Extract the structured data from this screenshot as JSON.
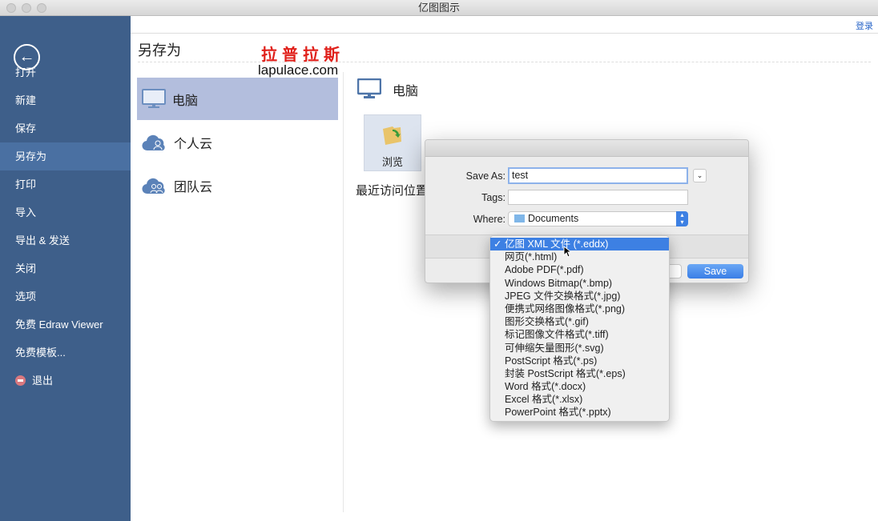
{
  "window": {
    "title": "亿图图示"
  },
  "sidebar": {
    "items": [
      {
        "label": "打开"
      },
      {
        "label": "新建"
      },
      {
        "label": "保存"
      },
      {
        "label": "另存为",
        "selected": true
      },
      {
        "label": "打印"
      },
      {
        "label": "导入"
      },
      {
        "label": "导出 & 发送"
      },
      {
        "label": "关闭"
      },
      {
        "label": "选项"
      },
      {
        "label": "免费 Edraw Viewer"
      },
      {
        "label": "免费模板..."
      },
      {
        "label": "退出"
      }
    ]
  },
  "header": {
    "login": "登录",
    "title": "另存为"
  },
  "watermark": {
    "cn": "拉普拉斯",
    "url": "lapulace.com"
  },
  "locations": [
    {
      "label": "电脑",
      "icon": "monitor-icon",
      "selected": true
    },
    {
      "label": "个人云",
      "icon": "cloud-user-icon"
    },
    {
      "label": "团队云",
      "icon": "cloud-team-icon"
    }
  ],
  "right": {
    "title": "电脑",
    "browse": "浏览",
    "recent": "最近访问位置"
  },
  "dialog": {
    "save_as_label": "Save As:",
    "save_as_value": "test",
    "tags_label": "Tags:",
    "tags_value": "",
    "where_label": "Where:",
    "where_value": "Documents",
    "save": "Save"
  },
  "format_menu": {
    "selected": 0,
    "options": [
      "亿图 XML 文件 (*.eddx)",
      "网页(*.html)",
      "Adobe PDF(*.pdf)",
      "Windows Bitmap(*.bmp)",
      "JPEG 文件交换格式(*.jpg)",
      "便携式网络图像格式(*.png)",
      "图形交换格式(*.gif)",
      "标记图像文件格式(*.tiff)",
      "可伸缩矢量图形(*.svg)",
      "PostScript 格式(*.ps)",
      "封装 PostScript 格式(*.eps)",
      "Word 格式(*.docx)",
      "Excel 格式(*.xlsx)",
      "PowerPoint 格式(*.pptx)"
    ]
  },
  "colors": {
    "sidebar": "#3e5f8a",
    "sidebar_selected": "#4a70a2",
    "location_selected": "#b3bedd",
    "accent": "#3d80e3",
    "watermark": "#e0201a"
  }
}
